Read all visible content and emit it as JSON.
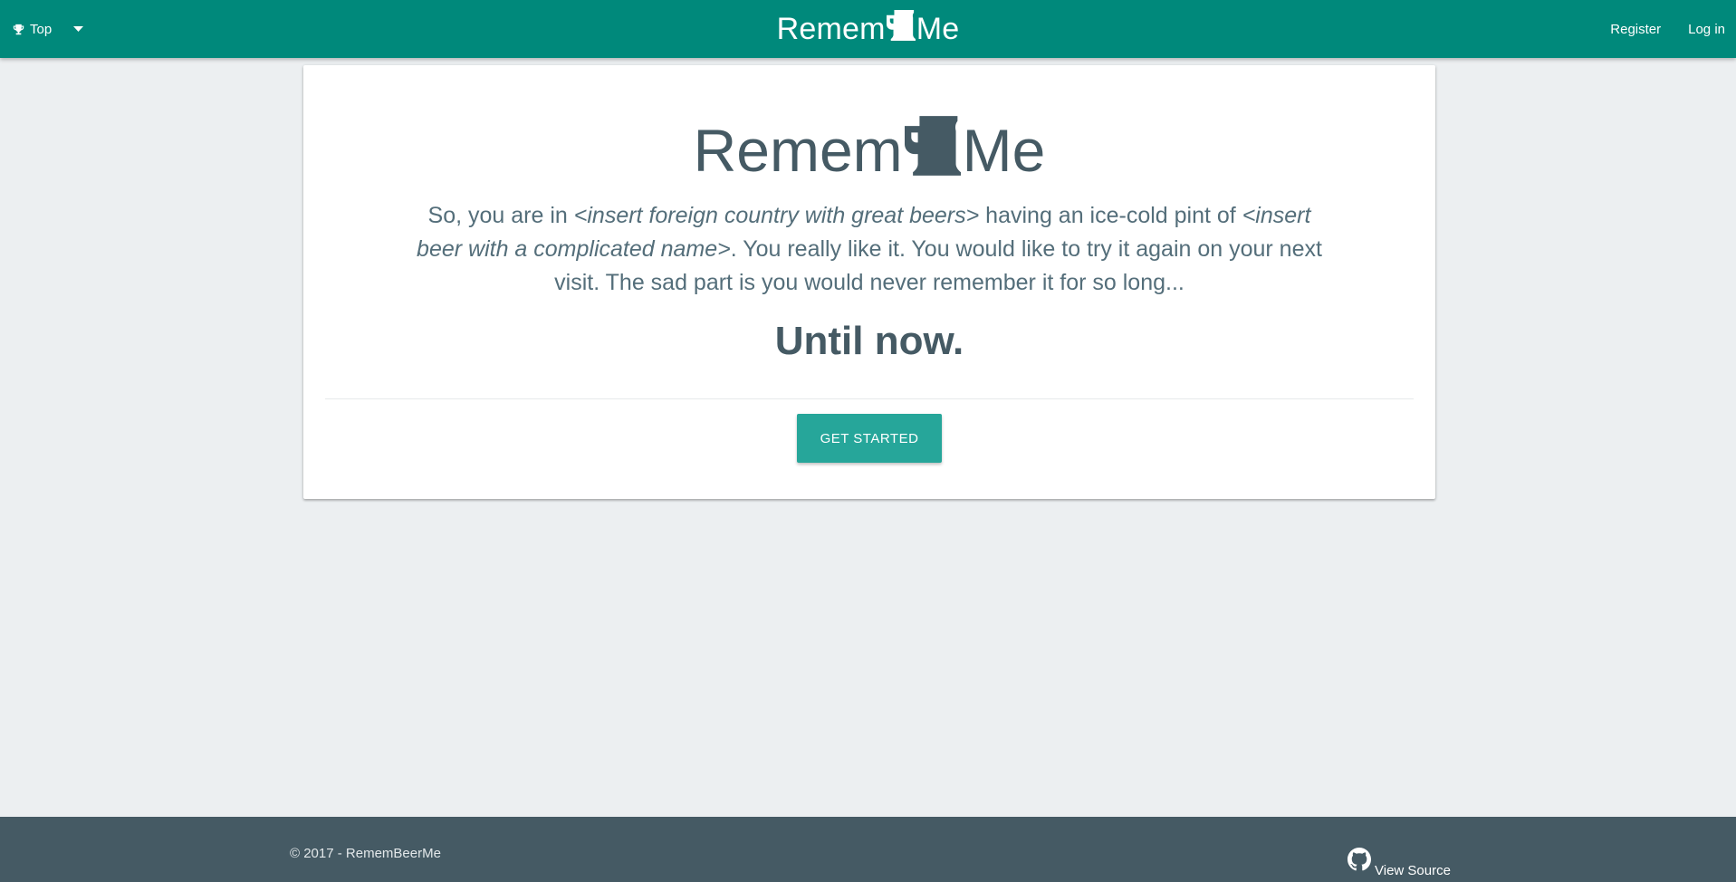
{
  "colors": {
    "navbar": "#00897b",
    "background": "#eceff1",
    "card": "#ffffff",
    "text": "#455a64",
    "button": "#26a69a",
    "footer": "#455a64"
  },
  "navbar": {
    "menu_icon": "trophy-icon",
    "menu_label": "Top",
    "caret_icon": "caret-down-icon",
    "brand_left": "Remem",
    "brand_icon": "beer-mug-icon",
    "brand_right": "Me",
    "register_label": "Register",
    "login_label": "Log in"
  },
  "hero": {
    "title_left": "Remem",
    "title_icon": "beer-mug-icon",
    "title_right": "Me",
    "text_1": "So, you are in ",
    "text_2": "<insert foreign country with great beers>",
    "text_3": " having an ice-cold pint of ",
    "text_4": "<insert beer with a complicated name>",
    "text_5": ". You really like it. You would like to try it again on your next visit. The sad part is you would never remember it for so long...",
    "tagline": "Until now.",
    "button_label": "GET STARTED"
  },
  "footer": {
    "copyright": "© 2017 - RememBeerMe",
    "source_icon": "github-icon",
    "source_label": "View Source"
  }
}
